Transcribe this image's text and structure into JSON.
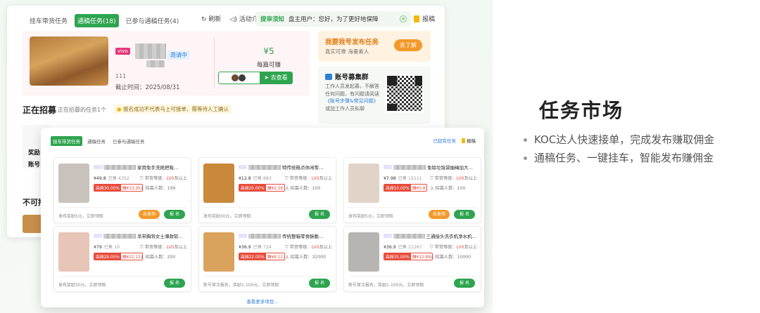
{
  "back_window": {
    "tabs": [
      "挂车带货任务",
      "通稿任务(18)",
      "已参与通稿任务(4)"
    ],
    "active_tab": 1,
    "refresh_label": "刷新",
    "intro_label": "活动介绍",
    "notice": {
      "highlight": "提审须知",
      "text": "盘主用户：您好，为了更好地保障"
    },
    "feedback_label": "报稿",
    "featured": {
      "platform_tag": "vivo",
      "status": "邀请中",
      "id": "111",
      "deadline": "截止时间：2025/08/31",
      "reward": "¥5",
      "reward_label": "每篇可赚",
      "view_label": "去查看"
    },
    "promo": {
      "title": "我要我号发布任务",
      "subtitle": "真实可靠 海量素人",
      "button": "去了解"
    },
    "qr_card": {
      "title": "账号募集群",
      "text_parts": [
        "工作人员发起募，不解答任何问题，有问题请阅读",
        "《账号步骤&常见问题》",
        "或加工作人员私聊"
      ]
    },
    "section_title": "正在招募",
    "section_sub": "正在招募的任务1个",
    "section_warn": "报名成功不代表马上可接单，需等待人工确认",
    "row_label_1": "奖励",
    "row_label_2": "账号",
    "unavailable_label": "不可持"
  },
  "front_window": {
    "tabs": [
      "挂车带货任务",
      "通稿任务",
      "已参与通稿任务"
    ],
    "active_tab": 0,
    "my_tasks_label": "已超有任务",
    "feedback_label": "报稿",
    "view_more": "查看更多项目...",
    "cards": [
      {
        "title": "家用免手洗拖把吸…",
        "price": "¥49.8",
        "sold": "已售 4352",
        "commission_rate": "高佣30.00%",
        "commission_amount": "赚¥13.95",
        "level_prefix": "带货等级：",
        "level": "LV0",
        "level_suffix": "及以上",
        "recruit": "招募人数：199",
        "foot": "发布奖励5元，立即领取",
        "buttons": [
          "去发布",
          "报 名"
        ],
        "img": "#c9c2bc"
      },
      {
        "title": "特传统糕点休闲零…",
        "price": "¥12.8",
        "sold": "已售 883",
        "commission_rate": "高佣20.00%",
        "commission_amount": "赚¥2.56",
        "level_prefix": "带货等级：",
        "level": "LV0",
        "level_suffix": "及以上",
        "recruit": "招募人数：100",
        "foot": "发布奖励30元，立即领取",
        "buttons": [
          "报 名"
        ],
        "img": "#c8893a"
      },
      {
        "title": "免除垃圾袋抽绳加大…",
        "price": "¥7.98",
        "sold": "已售 15111",
        "commission_rate": "高佣10.00%",
        "commission_amount": "赚¥0.8",
        "level_prefix": "带货等级：",
        "level": "LV0",
        "level_suffix": "及以上",
        "recruit": "招募人数：100",
        "foot": "发布奖励5元，立即领取",
        "buttons": [
          "去发布",
          "报 名"
        ],
        "img": "#e2d3c8"
      },
      {
        "title": "吊带胸背女士薄款软…",
        "price": "¥79",
        "sold": "已售 10",
        "commission_rate": "高佣28.00%",
        "commission_amount": "赚¥22.12",
        "level_prefix": "带货等级：",
        "level": "LV0",
        "level_suffix": "及以上",
        "recruit": "招募人数：200",
        "foot": "发布奖励30元，立即领取",
        "buttons": [
          "报 名"
        ],
        "img": "#e7c6b7"
      },
      {
        "title": "传统整箱零食酥脆…",
        "price": "¥36.9",
        "sold": "已售 724",
        "commission_rate": "高佣22.00%",
        "commission_amount": "赚¥8.12",
        "level_prefix": "带货等级：",
        "level": "LV0",
        "level_suffix": "及以上",
        "recruit": "招募人数：32000",
        "foot": "新号首次报名，奖励1-100元，立即领取",
        "buttons": [
          "报 名"
        ],
        "img": "#d9a35e"
      },
      {
        "title": "三通接头洗衣机净水机…",
        "price": "¥36.9",
        "sold": "已售 11267",
        "commission_rate": "高佣35.00%",
        "commission_amount": "赚¥12.89",
        "level_prefix": "带货等级：",
        "level": "LV0",
        "level_suffix": "及以上",
        "recruit": "招募人数：10000",
        "foot": "新号首次报名，奖励1-100元，立即领取",
        "buttons": [
          "报 名"
        ],
        "img": "#b7b5b2"
      }
    ]
  },
  "right_panel": {
    "title": "任务市场",
    "bullets": [
      "KOC达人快速接单，完成发布赚取佣金",
      "通稿任务、一键挂车，智能发布赚佣金"
    ]
  },
  "colors": {
    "accent": "#2ea44f",
    "warning": "#f39a2b",
    "danger": "#e74c3c",
    "link": "#2f7ed8"
  }
}
